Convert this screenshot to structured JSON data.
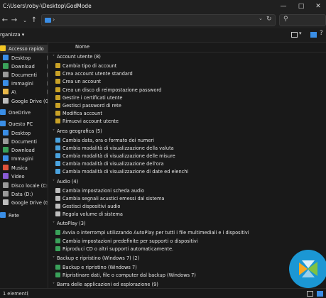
{
  "window": {
    "title": "C:\\Users\\roby-\\Desktop\\GodMode"
  },
  "commandbar": {
    "organize_label": "rganizza ▾"
  },
  "sidebar": {
    "items": [
      {
        "label": "Accesso rapido",
        "icon": "star-icon",
        "color": "#f3c623",
        "pinned": false
      },
      {
        "label": "Desktop",
        "icon": "desktop-folder-icon",
        "color": "#3a8ee6",
        "pinned": true
      },
      {
        "label": "Download",
        "icon": "download-folder-icon",
        "color": "#3aa15a",
        "pinned": true
      },
      {
        "label": "Documenti",
        "icon": "documents-folder-icon",
        "color": "#9a9a9a",
        "pinned": true
      },
      {
        "label": "Immagini",
        "icon": "pictures-folder-icon",
        "color": "#3a8ee6",
        "pinned": true
      },
      {
        "label": "A\\",
        "icon": "folder-icon",
        "color": "#e8b84a",
        "pinned": true
      },
      {
        "label": "Google Drive (G",
        "icon": "drive-icon",
        "color": "#bdbdbd",
        "pinned": true
      },
      {
        "label": "OneDrive",
        "icon": "cloud-icon",
        "color": "#3a8ee6",
        "pinned": false
      },
      {
        "label": "Questo PC",
        "icon": "pc-icon",
        "color": "#3a8ee6",
        "pinned": false
      },
      {
        "label": "Desktop",
        "icon": "desktop-folder-icon",
        "color": "#3a8ee6",
        "pinned": false
      },
      {
        "label": "Documenti",
        "icon": "documents-folder-icon",
        "color": "#9a9a9a",
        "pinned": false
      },
      {
        "label": "Download",
        "icon": "download-folder-icon",
        "color": "#3aa15a",
        "pinned": false
      },
      {
        "label": "Immagini",
        "icon": "pictures-folder-icon",
        "color": "#3a8ee6",
        "pinned": false
      },
      {
        "label": "Musica",
        "icon": "music-folder-icon",
        "color": "#e0533b",
        "pinned": false
      },
      {
        "label": "Video",
        "icon": "video-folder-icon",
        "color": "#8a5bd6",
        "pinned": false
      },
      {
        "label": "Disco locale (C:)",
        "icon": "disk-icon",
        "color": "#9a9a9a",
        "pinned": false
      },
      {
        "label": "Data (D:)",
        "icon": "disk-icon",
        "color": "#9a9a9a",
        "pinned": false
      },
      {
        "label": "Google Drive (G:)",
        "icon": "drive-icon",
        "color": "#bdbdbd",
        "pinned": false
      },
      {
        "label": "Rete",
        "icon": "network-icon",
        "color": "#3a8ee6",
        "pinned": false
      }
    ]
  },
  "main": {
    "column_header": "Nome",
    "groups": [
      {
        "title": "Account utente (8)",
        "icon_color": "#c9a227",
        "items": [
          "Cambia tipo di account",
          "Crea account utente standard",
          "Crea un account",
          "Crea un disco di reimpostazione password",
          "Gestire i certificati utente",
          "Gestisci password di rete",
          "Modifica account",
          "Rimuovi account utente"
        ]
      },
      {
        "title": "Area geografica (5)",
        "icon_color": "#4aa3df",
        "items": [
          "Cambia data, ora o formato dei numeri",
          "Cambia modalità di visualizzazione della valuta",
          "Cambia modalità di visualizzazione delle misure",
          "Cambia modalità di visualizzazione dell'ora",
          "Cambia modalità di visualizzazione di date ed elenchi"
        ]
      },
      {
        "title": "Audio (4)",
        "icon_color": "#bdbdbd",
        "items": [
          "Cambia impostazioni scheda audio",
          "Cambia segnali acustici emessi dal sistema",
          "Gestisci dispositivi audio",
          "Regola volume di sistema"
        ]
      },
      {
        "title": "AutoPlay (3)",
        "icon_color": "#3aa15a",
        "items": [
          "Avvia o interrompi utilizzando AutoPlay per tutti i file multimediali e i dispositivi",
          "Cambia impostazioni predefinite per supporti o dispositivi",
          "Riproduci CD o altri supporti automaticamente."
        ]
      },
      {
        "title": "Backup e ripristino (Windows 7) (2)",
        "icon_color": "#3aa15a",
        "items": [
          "Backup e ripristino (Windows 7)",
          "Ripristinare dati, file o computer dal backup (Windows 7)"
        ]
      },
      {
        "title": "Barra delle applicazioni ed esplorazione (9)",
        "icon_color": "#4aa3df",
        "items": []
      }
    ]
  },
  "status": {
    "count": "1 elementi"
  },
  "colors": {
    "accent": "#1b97d4",
    "selection": "#333333"
  }
}
